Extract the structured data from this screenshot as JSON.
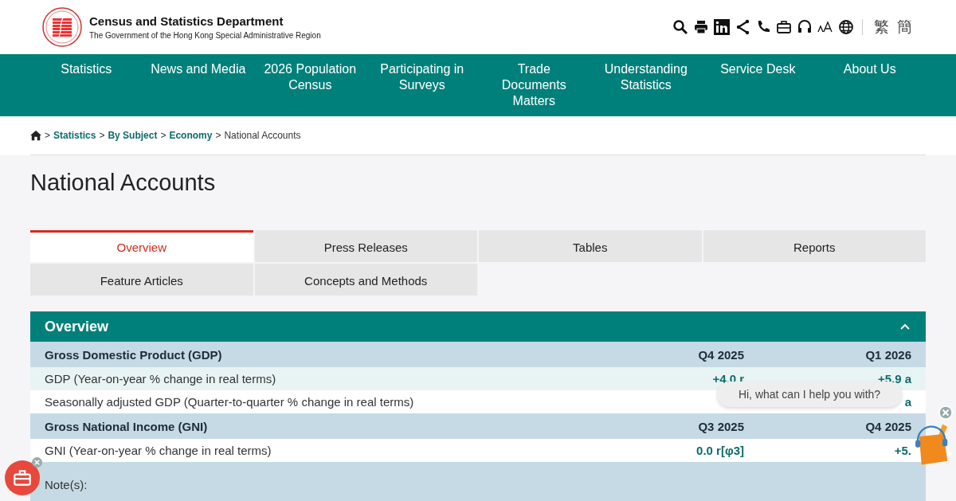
{
  "header": {
    "title": "Census and Statistics Department",
    "subtitle": "The Government of the Hong Kong Special Administrative Region",
    "languages": [
      "繁",
      "簡"
    ]
  },
  "nav": [
    "Statistics",
    "News and Media",
    "2026 Population Census",
    "Participating in Surveys",
    "Trade Documents Matters",
    "Understanding Statistics",
    "Service Desk",
    "About Us"
  ],
  "breadcrumb": {
    "separator": ">",
    "links": [
      "Statistics",
      "By Subject",
      "Economy"
    ],
    "current": "National Accounts"
  },
  "page_title": "National Accounts",
  "tabs": [
    {
      "label": "Overview",
      "selected": true
    },
    {
      "label": "Press Releases",
      "selected": false
    },
    {
      "label": "Tables",
      "selected": false
    },
    {
      "label": "Reports",
      "selected": false
    },
    {
      "label": "Feature Articles",
      "selected": false
    },
    {
      "label": "Concepts and Methods",
      "selected": false
    }
  ],
  "panel": {
    "title": "Overview",
    "expanded": true
  },
  "table": [
    {
      "kind": "group",
      "label": "Gross Domestic Product (GDP)",
      "column_2": "Q4 2025",
      "column_3": "Q1 2026"
    },
    {
      "kind": "row",
      "label": "GDP (Year-on-year % change in real terms)",
      "column_2": "+4.0 r",
      "column_3": "+5.9 a"
    },
    {
      "kind": "row",
      "label": "Seasonally adjusted GDP (Quarter-to-quarter % change in real terms)",
      "column_3": "a"
    },
    {
      "kind": "group",
      "label": "Gross National Income (GNI)",
      "column_2": "Q3 2025",
      "column_3": "Q4 2025"
    },
    {
      "kind": "row",
      "label": "GNI (Year-on-year % change in real terms)",
      "column_2": "0.0 r[φ3]",
      "column_3": "+5."
    }
  ],
  "notes_label": "Note(s):",
  "chat_bubble": "Hi, what can I help you with?"
}
